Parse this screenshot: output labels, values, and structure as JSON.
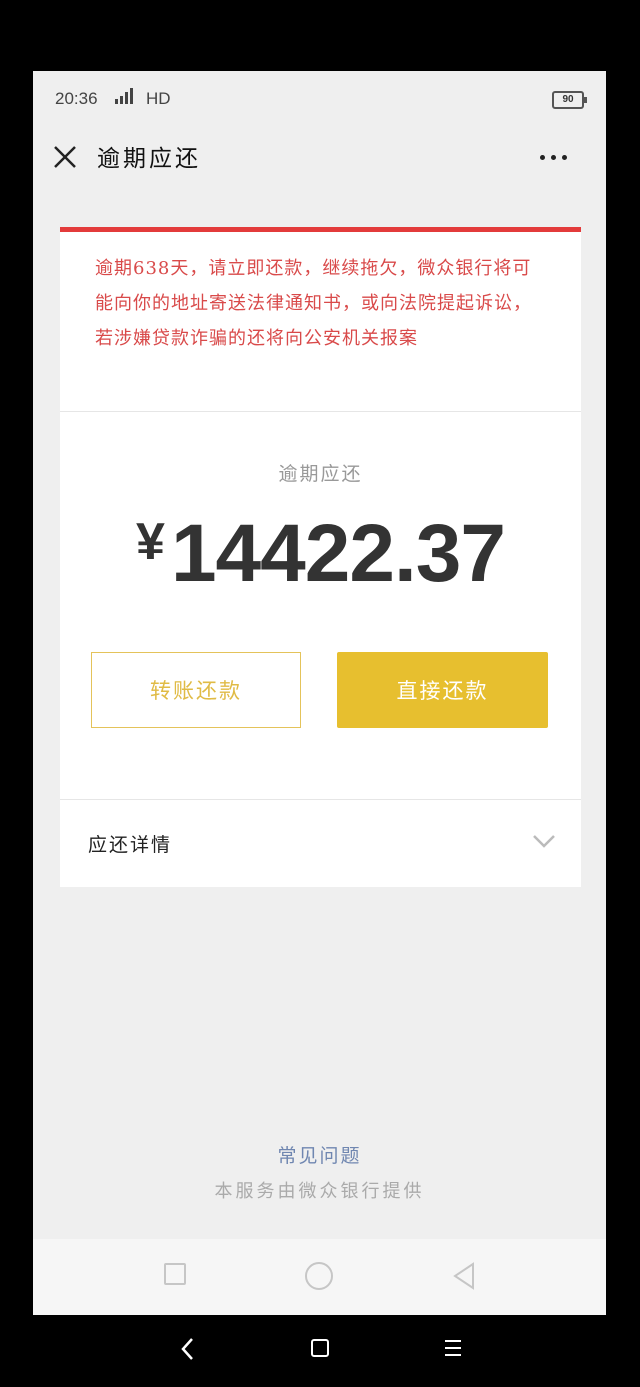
{
  "statusbar": {
    "time": "20:36",
    "network": "HD",
    "battery": "90"
  },
  "header": {
    "title": "逾期应还"
  },
  "notice": {
    "warning": "逾期638天，请立即还款，继续拖欠，微众银行将可能向你的地址寄送法律通知书，或向法院提起诉讼，若涉嫌贷款诈骗的还将向公安机关报案"
  },
  "due": {
    "label": "逾期应还",
    "currency": "¥",
    "amount": "14422.37"
  },
  "actions": {
    "transfer_label": "转账还款",
    "pay_label": "直接还款"
  },
  "details": {
    "label": "应还详情"
  },
  "footer": {
    "faq": "常见问题",
    "provider": "本服务由微众银行提供"
  },
  "colors": {
    "warning_red": "#d94a4a",
    "accent_gold": "#e7bf2f",
    "link_blue": "#6f86b0"
  }
}
